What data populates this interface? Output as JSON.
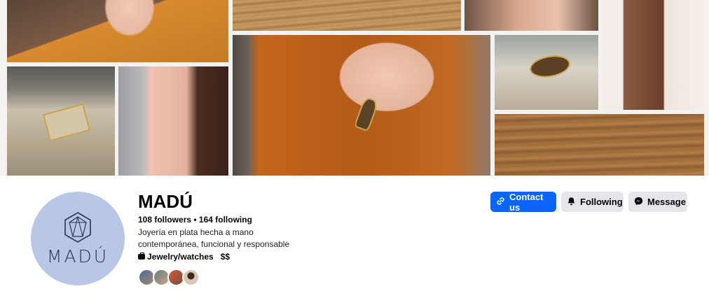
{
  "profile": {
    "name": "MADÚ",
    "stats": "108 followers • 164 following",
    "bio_line1": "Joyería en plata hecha a mano",
    "bio_line2": "contemporánea, funcional y responsable",
    "category": "Jewelry/watches",
    "price_range": "$$",
    "avatar_text": "MADÚ"
  },
  "actions": {
    "contact_label": "Contact us",
    "following_label": "Following",
    "message_label": "Message"
  },
  "icons": {
    "contact": "link-icon",
    "following": "bell-icon",
    "message": "messenger-icon",
    "category": "briefcase-icon"
  },
  "colors": {
    "primary": "#0866ff",
    "secondary_bg": "#e4e6eb",
    "avatar_bg": "#b9c7e6"
  }
}
